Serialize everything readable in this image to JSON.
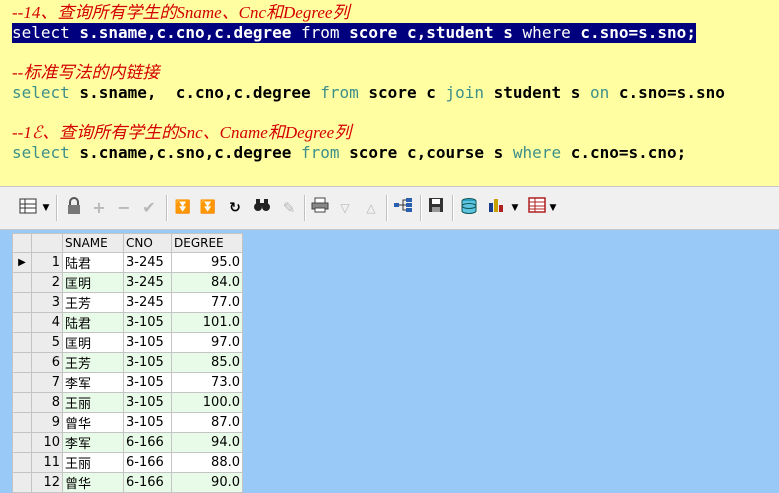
{
  "editor": {
    "comment1": "--14、查询所有学生的Sname、Cnc和Degree列",
    "line1_kw1": "select",
    "line1_p1": " s.sname,c.cno,c.degree ",
    "line1_kw2": "from",
    "line1_p2": " score c,student s ",
    "line1_kw3": "where",
    "line1_p3": " c.sno=s.sno;",
    "comment2": "--标准写法的内链接",
    "line2_kw1": "select",
    "line2_p1": " s.sname,  c.cno,c.degree ",
    "line2_kw2": "from",
    "line2_p2": " score c ",
    "line2_kw3": "join",
    "line2_p3": " student s ",
    "line2_kw4": "on",
    "line2_p4": " c.sno=s.sno",
    "comment3": "--1ℰ、查询所有学生的Snc、Cname和Degree列",
    "line3_kw1": "select",
    "line3_p1": " s.cname,c.sno,c.degree ",
    "line3_kw2": "from",
    "line3_p2": " score c,course s ",
    "line3_kw3": "where",
    "line3_p3": " c.cno=s.cno;"
  },
  "toolbar": {
    "icons": [
      "grid-layout-icon",
      "dropdown-arrow-icon",
      "lock-icon",
      "plus-icon",
      "minus-icon",
      "check-icon",
      "filter-down-icon",
      "filter-clear-icon",
      "refresh-icon",
      "binoculars-icon",
      "eraser-icon",
      "print-icon",
      "arrow-down-icon",
      "arrow-up-icon",
      "tree-icon",
      "save-icon",
      "database-icon",
      "chart-icon",
      "table-export-icon"
    ]
  },
  "grid": {
    "columns": [
      "SNAME",
      "CNO",
      "DEGREE"
    ],
    "current_row_marker": "▶",
    "rows": [
      {
        "n": "1",
        "sname": "陆君",
        "cno": "3-245",
        "degree": "95.0"
      },
      {
        "n": "2",
        "sname": "匡明",
        "cno": "3-245",
        "degree": "84.0"
      },
      {
        "n": "3",
        "sname": "王芳",
        "cno": "3-245",
        "degree": "77.0"
      },
      {
        "n": "4",
        "sname": "陆君",
        "cno": "3-105",
        "degree": "101.0"
      },
      {
        "n": "5",
        "sname": "匡明",
        "cno": "3-105",
        "degree": "97.0"
      },
      {
        "n": "6",
        "sname": "王芳",
        "cno": "3-105",
        "degree": "85.0"
      },
      {
        "n": "7",
        "sname": "李军",
        "cno": "3-105",
        "degree": "73.0"
      },
      {
        "n": "8",
        "sname": "王丽",
        "cno": "3-105",
        "degree": "100.0"
      },
      {
        "n": "9",
        "sname": "曾华",
        "cno": "3-105",
        "degree": "87.0"
      },
      {
        "n": "10",
        "sname": "李军",
        "cno": "6-166",
        "degree": "94.0"
      },
      {
        "n": "11",
        "sname": "王丽",
        "cno": "6-166",
        "degree": "88.0"
      },
      {
        "n": "12",
        "sname": "曾华",
        "cno": "6-166",
        "degree": "90.0"
      }
    ]
  }
}
